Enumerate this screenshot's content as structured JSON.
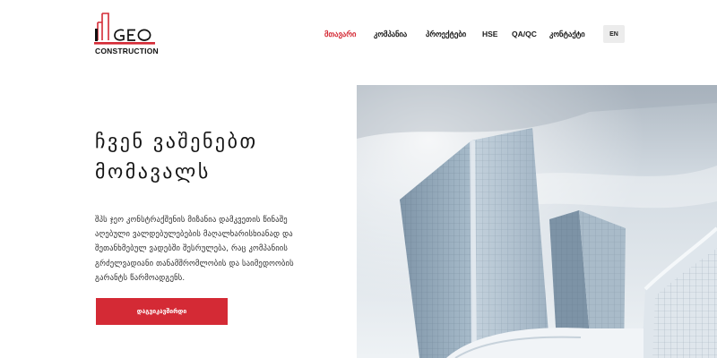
{
  "brand": {
    "logo_text": "GEO",
    "caption": "CONSTRUCTION",
    "accent_color": "#d42a35"
  },
  "nav": {
    "items": [
      {
        "label": "მთავარი",
        "active": true
      },
      {
        "label": "კომპანია",
        "active": false
      },
      {
        "label": "პროექტები",
        "active": false
      },
      {
        "label": "HSE",
        "active": false
      },
      {
        "label": "QA/QC",
        "active": false
      },
      {
        "label": "კონტაქტი",
        "active": false
      }
    ],
    "language": "EN"
  },
  "hero": {
    "title_line1": "ჩვენ ვაშენებთ",
    "title_line2": "მომავალს",
    "description": "შპს ჯეო კონსტრაქშენის მიზანია დამკვეთის წინაშე აღებული ვალდებულებების მაღალხარისხიანად და შეთანხმებულ ვადებში შესრულება, რაც კომპანიის გრძელვადიანი თანამშრომლობის და საიმედოობის გარანტს წარმოადგენს.",
    "cta_label": "დაგვიკავშირდი",
    "image_icon": "office-building-photo"
  }
}
